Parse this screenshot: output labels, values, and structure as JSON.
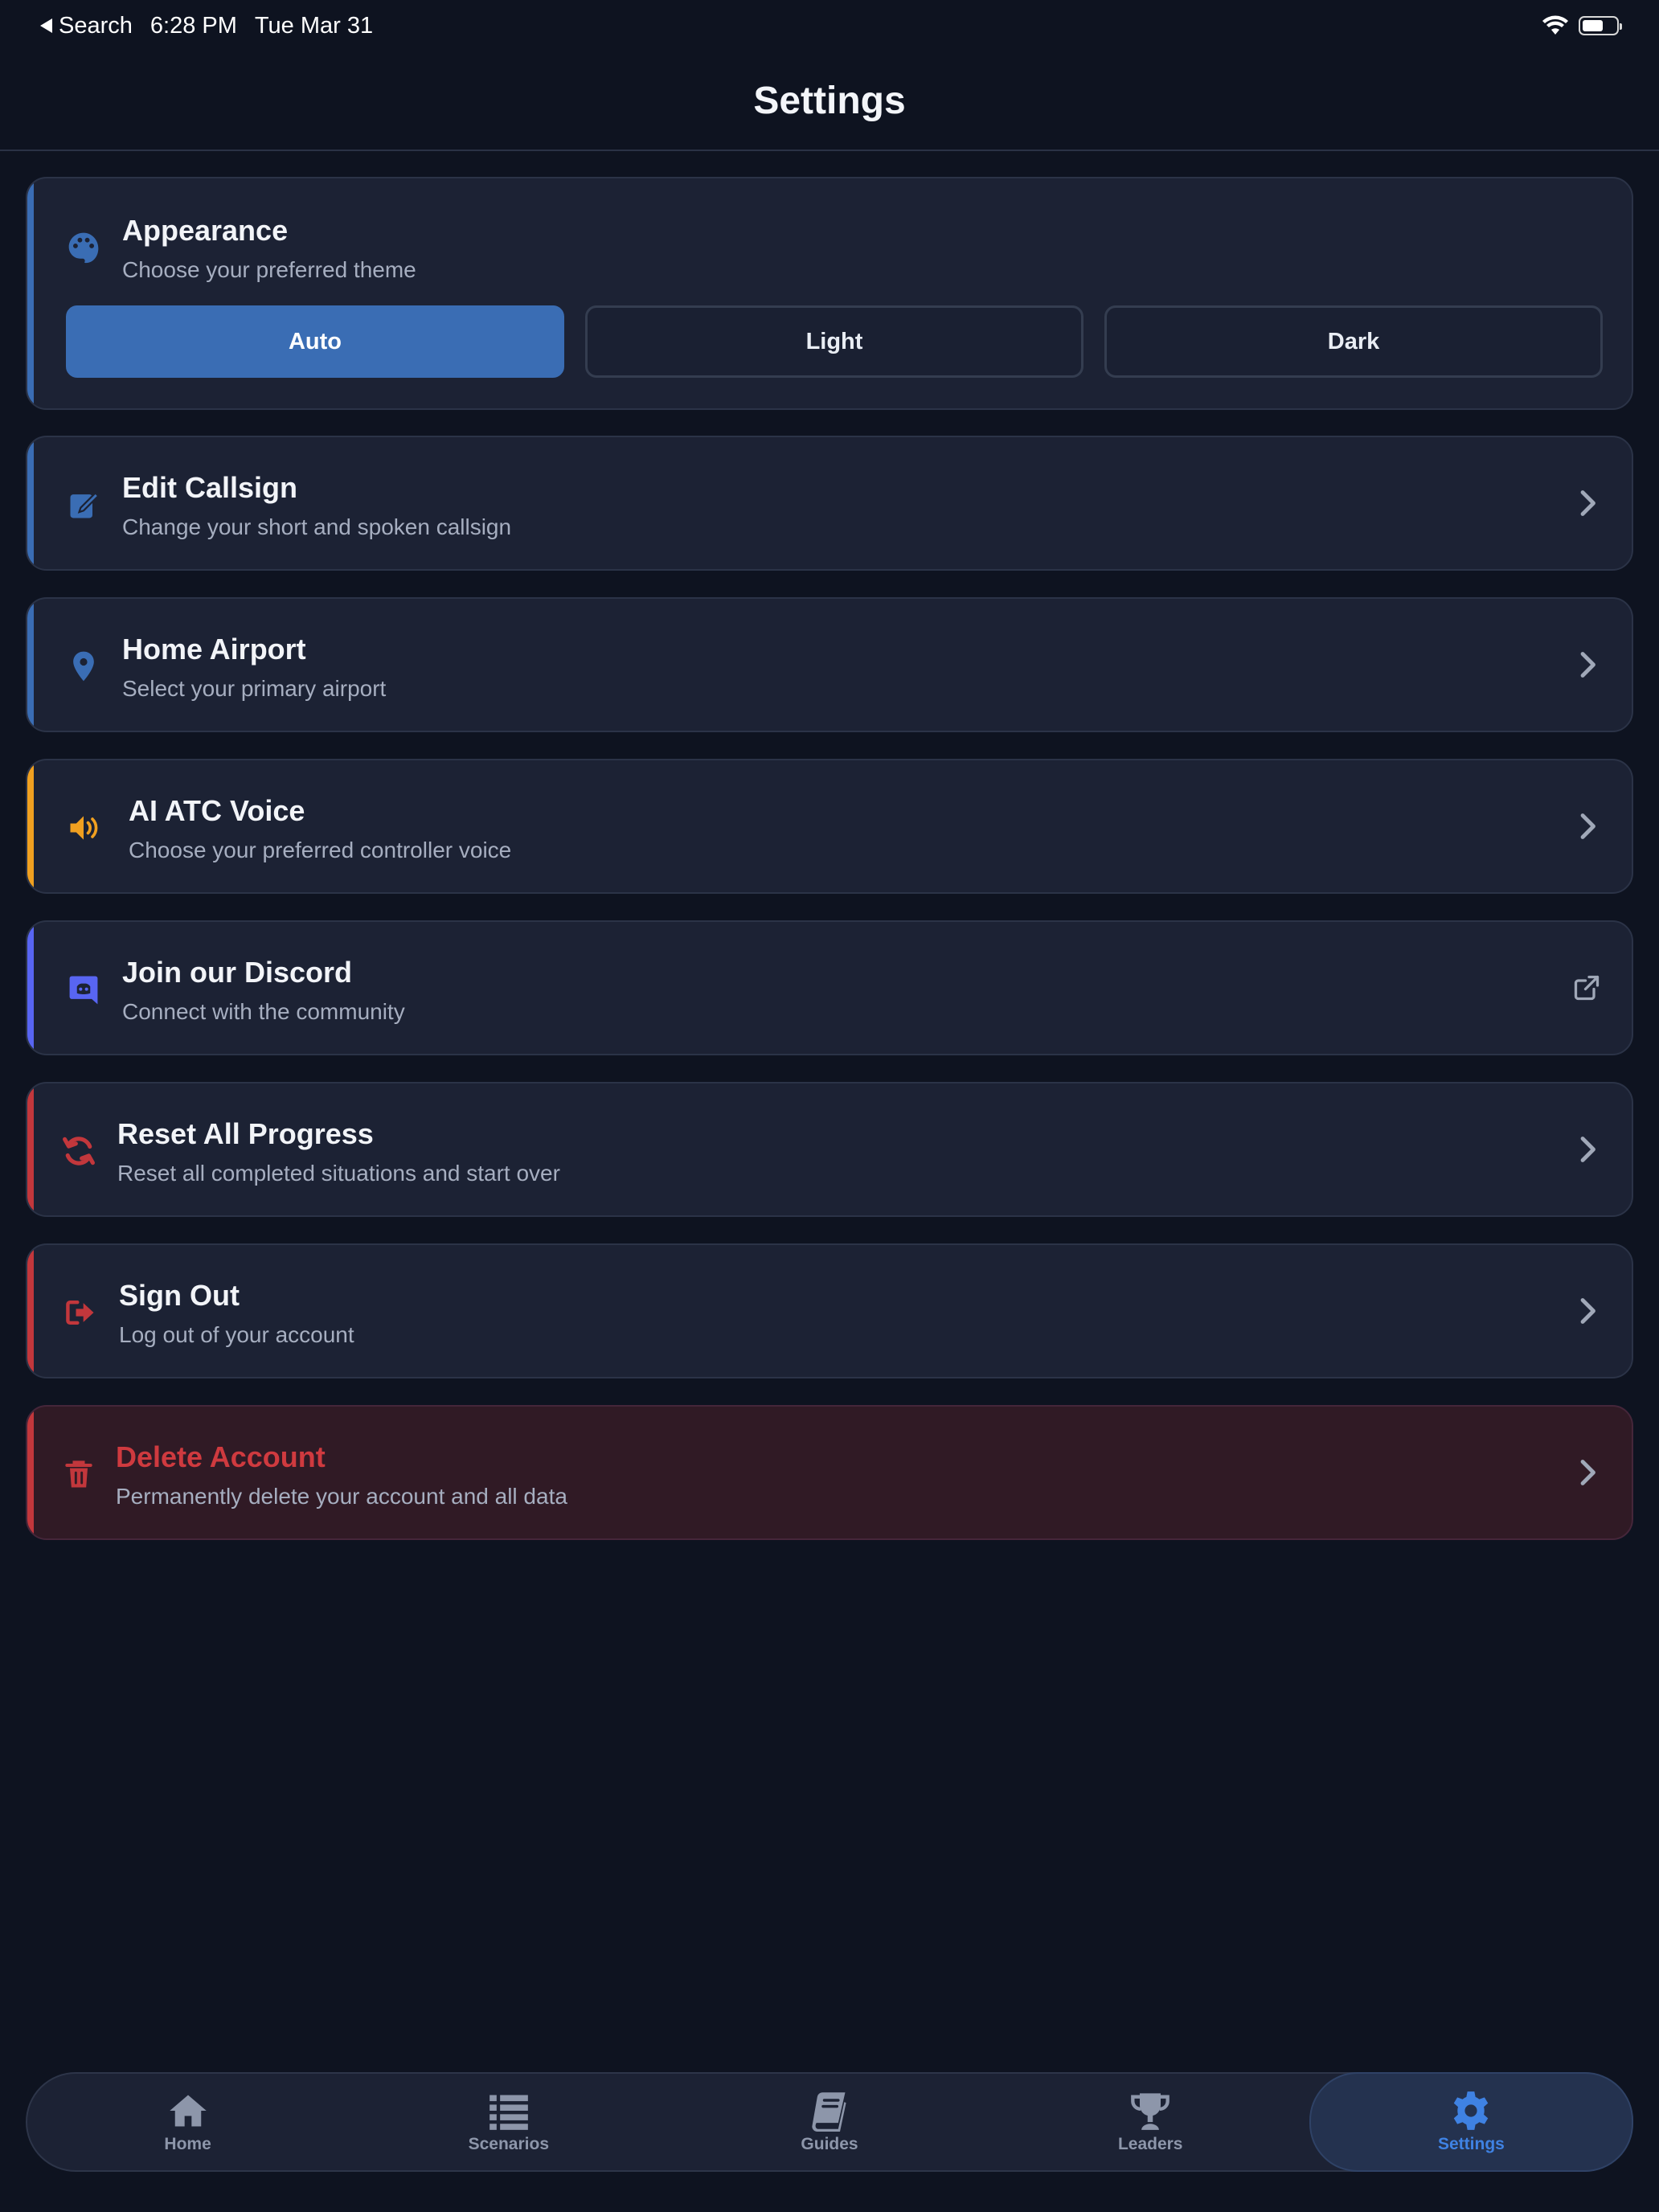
{
  "status_bar": {
    "back_label": "Search",
    "time": "6:28 PM",
    "date": "Tue Mar 31",
    "battery_level": 0.62
  },
  "header": {
    "title": "Settings"
  },
  "appearance": {
    "title": "Appearance",
    "subtitle": "Choose your preferred theme",
    "icon": "palette-icon",
    "options": [
      "Auto",
      "Light",
      "Dark"
    ],
    "selected": "Auto"
  },
  "items": [
    {
      "title": "Edit Callsign",
      "subtitle": "Change your short and spoken callsign",
      "icon": "edit-icon",
      "accent": "#3a6db4",
      "trailing": "chevron-right-icon"
    },
    {
      "title": "Home Airport",
      "subtitle": "Select your primary airport",
      "icon": "location-pin-icon",
      "accent": "#3a6db4",
      "trailing": "chevron-right-icon"
    },
    {
      "title": "AI ATC Voice",
      "subtitle": "Choose your preferred controller voice",
      "icon": "speaker-icon",
      "accent": "#f0a020",
      "trailing": "chevron-right-icon"
    },
    {
      "title": "Join our Discord",
      "subtitle": "Connect with the community",
      "icon": "discord-icon",
      "accent": "#5865f2",
      "trailing": "external-link-icon"
    },
    {
      "title": "Reset All Progress",
      "subtitle": "Reset all completed situations and start over",
      "icon": "refresh-icon",
      "accent": "#c2373c",
      "trailing": "chevron-right-icon"
    },
    {
      "title": "Sign Out",
      "subtitle": "Log out of your account",
      "icon": "sign-out-icon",
      "accent": "#c2373c",
      "trailing": "chevron-right-icon"
    },
    {
      "title": "Delete Account",
      "subtitle": "Permanently delete your account and all data",
      "icon": "trash-icon",
      "accent": "#c2373c",
      "trailing": "chevron-right-icon"
    }
  ],
  "tabs": [
    {
      "label": "Home",
      "icon": "home-icon"
    },
    {
      "label": "Scenarios",
      "icon": "list-icon"
    },
    {
      "label": "Guides",
      "icon": "book-icon"
    },
    {
      "label": "Leaders",
      "icon": "trophy-icon"
    },
    {
      "label": "Settings",
      "icon": "gear-icon",
      "active": true
    }
  ],
  "colors": {
    "background": "#0e1320",
    "card": "#1c2234",
    "accent_blue": "#3a6db4",
    "accent_orange": "#f0a020",
    "accent_discord": "#5865f2",
    "accent_red": "#c2373c",
    "active_tab": "#3f82e3"
  }
}
